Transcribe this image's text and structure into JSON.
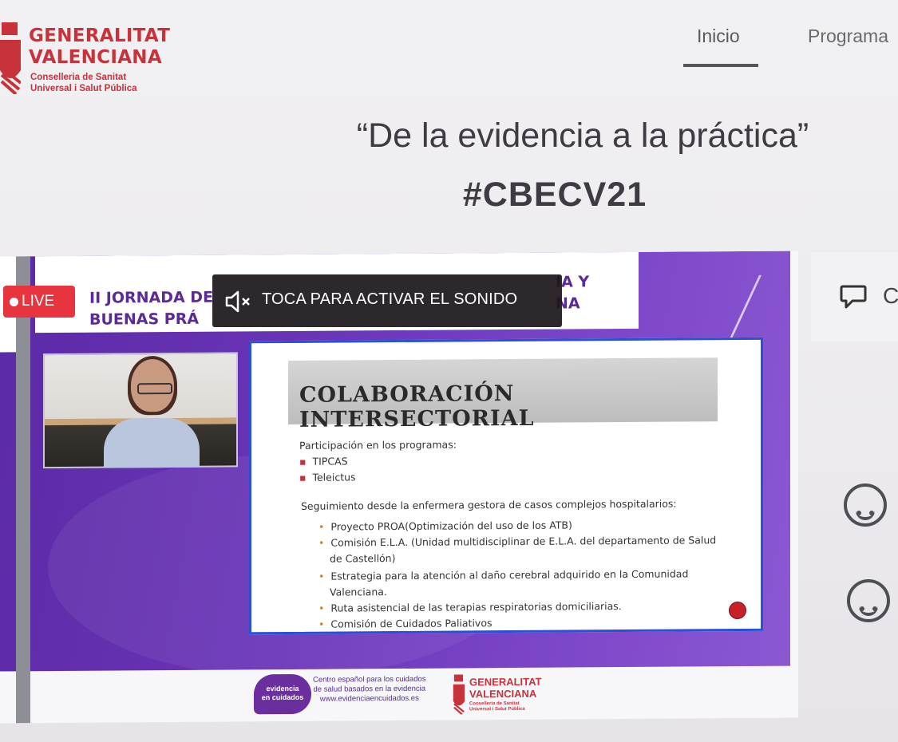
{
  "header": {
    "logo_name_line1": "GENERALITAT",
    "logo_name_line2": "VALENCIANA",
    "logo_sub_line1": "Conselleria de Sanitat",
    "logo_sub_line2": "Universal i Salut Pública",
    "brand_color": "#c8323b"
  },
  "nav": {
    "items": [
      {
        "label": "Inicio",
        "active": true
      },
      {
        "label": "Programa",
        "active": false
      }
    ]
  },
  "slogan": {
    "quote": "“De la evidencia a la práctica”",
    "hashtag": "#CBECV21"
  },
  "stream": {
    "live_label": "LIVE",
    "sound_prompt": "TOCA PARA ACTIVAR EL SONIDO",
    "banner_line1": "II JORNADA DE",
    "banner_line2": "BUENAS PRÁ",
    "banner_right1": "IA Y",
    "banner_right2": "NA",
    "accent_color": "#6a35b8"
  },
  "slide": {
    "title": "COLABORACIÓN INTERSECTORIAL",
    "participation_heading": "Participación en los programas:",
    "programs": [
      "TIPCAS",
      "Teleictus"
    ],
    "followup_heading": "Seguimiento desde la enfermera gestora de casos complejos     hospitalarios:",
    "items": [
      "Proyecto PROA(Optimización del uso de los ATB)",
      "Comisión E.L.A. (Unidad multidisciplinar de E.L.A. del departamento de Salud",
      "de Castellón)",
      "Estrategia para la atención al daño cerebral adquirido en la Comunidad",
      "Valenciana.",
      "Ruta asistencial de las terapias respiratorias domiciliarias.",
      "Comisión de Cuidados Paliativos"
    ]
  },
  "footer": {
    "badge_line1": "evidencia",
    "badge_line2": "en cuidados",
    "evid_line1": "Centro español para los cuidados",
    "evid_line2": "de salud basados en la evidencia",
    "evid_line3": "www.evidenciaencuidados.es",
    "gv_line1": "GENERALITAT",
    "gv_line2": "VALENCIANA",
    "gv_sub1": "Conselleria de Sanitat",
    "gv_sub2": "Universal i Salut Pública"
  },
  "side": {
    "partial_letter": "C",
    "icons": [
      "chat-bubble-icon",
      "smiley-icon",
      "smiley-icon"
    ]
  }
}
